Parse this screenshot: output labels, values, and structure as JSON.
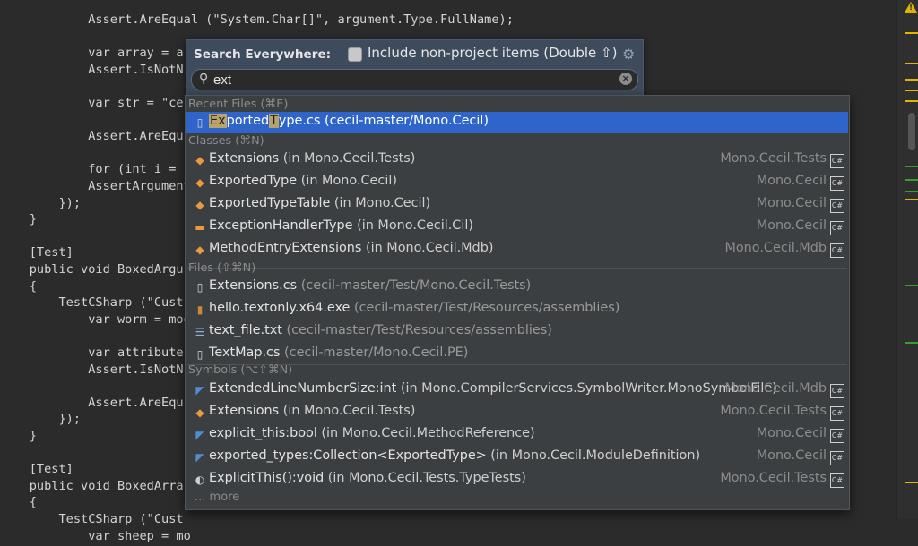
{
  "editor": {
    "lines": [
      {
        "text": "            Assert.AreEqual (\"System.Char[]\", argument.Type.FullName);"
      },
      {
        "text": ""
      },
      {
        "text": "            var array = a"
      },
      {
        "text": "            Assert.IsNotN"
      },
      {
        "text": ""
      },
      {
        "text": "            var str = \"ce"
      },
      {
        "text": ""
      },
      {
        "text": "            Assert.AreEqu"
      },
      {
        "text": ""
      },
      {
        "text": "            for (int i = "
      },
      {
        "text": "            AssertArgument"
      },
      {
        "text": "        });"
      },
      {
        "text": "    }"
      },
      {
        "text": ""
      },
      {
        "text": "    [Test]"
      },
      {
        "text": "    public void BoxedArgu"
      },
      {
        "text": "    {"
      },
      {
        "text": "        TestCSharp (\"Cust"
      },
      {
        "text": "            var worm = mod"
      },
      {
        "text": ""
      },
      {
        "text": "            var attribute"
      },
      {
        "text": "            Assert.IsNotN"
      },
      {
        "text": ""
      },
      {
        "text": "            Assert.AreEqu"
      },
      {
        "text": "        });"
      },
      {
        "text": "    }"
      },
      {
        "text": ""
      },
      {
        "text": "    [Test]"
      },
      {
        "text": "    public void BoxedArra"
      },
      {
        "text": "    {"
      },
      {
        "text": "        TestCSharp (\"Cust"
      },
      {
        "text": "            var sheep = mo"
      }
    ]
  },
  "search": {
    "title": "Search Everywhere:",
    "include_label": "Include non-project items (Double ⇧)",
    "query": "ext",
    "gear_icon": "gear-icon",
    "search_icon": "search-icon",
    "clear_icon": "clear-icon"
  },
  "results": {
    "recent_files_header": "Recent Files (⌘E)",
    "recent": [
      {
        "hl1": "Ex",
        "mid": "ported",
        "hl2": "T",
        "rest": "ype.cs",
        "path": " (cecil-master/Mono.Cecil)"
      }
    ],
    "classes_header": "Classes (⌘N)",
    "classes": [
      {
        "name": "Extensions",
        "loc": "  (in Mono.Cecil.Tests)",
        "module": "Mono.Cecil.Tests",
        "icon": "class-icon"
      },
      {
        "name": "ExportedType",
        "loc": "  (in Mono.Cecil)",
        "module": "Mono.Cecil",
        "icon": "class-icon"
      },
      {
        "name": "ExportedTypeTable",
        "loc": "  (in Mono.Cecil)",
        "module": "Mono.Cecil",
        "icon": "class-icon"
      },
      {
        "name": "ExceptionHandlerType",
        "loc": "  (in Mono.Cecil.Cil)",
        "module": "Mono.Cecil",
        "icon": "enum-icon"
      },
      {
        "name": "MethodEntryExtensions",
        "loc": "  (in Mono.Cecil.Mdb)",
        "module": "Mono.Cecil.Mdb",
        "icon": "class-icon"
      }
    ],
    "files_header": "Files (⇧⌘N)",
    "files": [
      {
        "name": "Extensions.cs",
        "path": " (cecil-master/Test/Mono.Cecil.Tests)",
        "icon": "csharp-file-icon"
      },
      {
        "name": "hello.textonly.x64.exe",
        "path": " (cecil-master/Test/Resources/assemblies)",
        "icon": "exe-file-icon"
      },
      {
        "name": "text_file.txt",
        "path": " (cecil-master/Test/Resources/assemblies)",
        "icon": "text-file-icon"
      },
      {
        "name": "TextMap.cs",
        "path": " (cecil-master/Mono.Cecil.PE)",
        "icon": "csharp-file-icon"
      }
    ],
    "symbols_header": "Symbols (⌥⇧⌘N)",
    "symbols": [
      {
        "name": "ExtendedLineNumberSize:int",
        "loc": "  (in Mono.CompilerServices.SymbolWriter.MonoSymbolFile)",
        "module": "Mono.Cecil.Mdb",
        "icon": "field-icon"
      },
      {
        "name": "Extensions",
        "loc": "  (in Mono.Cecil.Tests)",
        "module": "Mono.Cecil.Tests",
        "icon": "class-icon"
      },
      {
        "name": "explicit_this:bool",
        "loc": "  (in Mono.Cecil.MethodReference)",
        "module": "Mono.Cecil",
        "icon": "field-icon"
      },
      {
        "name": "exported_types:Collection<ExportedType>",
        "loc": "  (in Mono.Cecil.ModuleDefinition)",
        "module": "Mono.Cecil",
        "icon": "field-icon"
      },
      {
        "name": "ExplicitThis():void",
        "loc": "  (in Mono.Cecil.Tests.TypeTests)",
        "module": "Mono.Cecil.Tests",
        "icon": "method-icon"
      }
    ],
    "more_label": "... more"
  },
  "colors": {
    "selection": "#2f65ca",
    "popup_bg": "#3c3f41",
    "search_head_bg": "#3d4b5c",
    "warning": "#e0b400"
  }
}
